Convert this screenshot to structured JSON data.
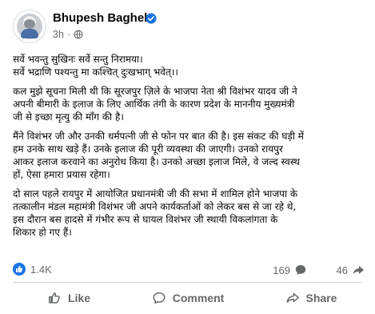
{
  "post": {
    "author": "Bhupesh Baghel",
    "time": "3h",
    "separator": "·",
    "paragraphs": [
      [
        "सर्वे भवन्तु सुखिनः सर्वे सन्तु निरामया।",
        "सर्वे भद्राणि पश्यन्तु मा कश्चित् दुःखभाग् भवेत्।।"
      ],
      [
        "कल मुझे सूचना मिली थी कि सूरजपुर ज़िले के भाजपा नेता श्री विशंभर यादव जी ने",
        "अपनी बीमारी के इलाज के लिए आर्थिक तंगी के कारण प्रदेश के माननीय मुख्यमंत्री",
        "जी से इच्छा मृत्यु की माँग की है।"
      ],
      [
        "मैंने विशंभर जी और उनकी धर्मपत्नी जी से फोन पर बात की है। इस संकट की घड़ी में",
        "हम उनके साथ खड़े हैं। उनके इलाज की पूरी व्यवस्था की जाएगी। उनको रायपुर",
        "आकर इलाज करवाने का अनुरोध किया है। उनको अच्छा इलाज मिले, वे जल्द स्वस्थ",
        "हों, ऐसा हमारा प्रयास रहेगा।"
      ],
      [
        "दो साल पहले रायपुर में आयोजित प्रधानमंत्री जी की सभा में शामिल होने भाजपा के",
        "तत्कालीन मंडल महामंत्री विशंभर जी अपने कार्यकर्ताओं को लेकर बस से जा रहे थे,",
        "इस दौरान बस हादसे में गंभीर रूप से घायल विशंभर जी स्थायी विकलांगता के",
        "शिकार हो गए हैं।"
      ]
    ]
  },
  "stats": {
    "likes": "1.4K",
    "comments": "169",
    "shares": "46"
  },
  "actions": {
    "like": "Like",
    "comment": "Comment",
    "share": "Share"
  },
  "colors": {
    "accent": "#1b74e4",
    "secondary_text": "#65676b",
    "divider": "#ced0d4"
  },
  "icons": {
    "verified": "verified-badge-icon",
    "privacy": "globe-icon",
    "like_reaction": "thumbs-up-icon",
    "comments": "comment-bubble-icon",
    "shares": "share-arrow-icon"
  }
}
